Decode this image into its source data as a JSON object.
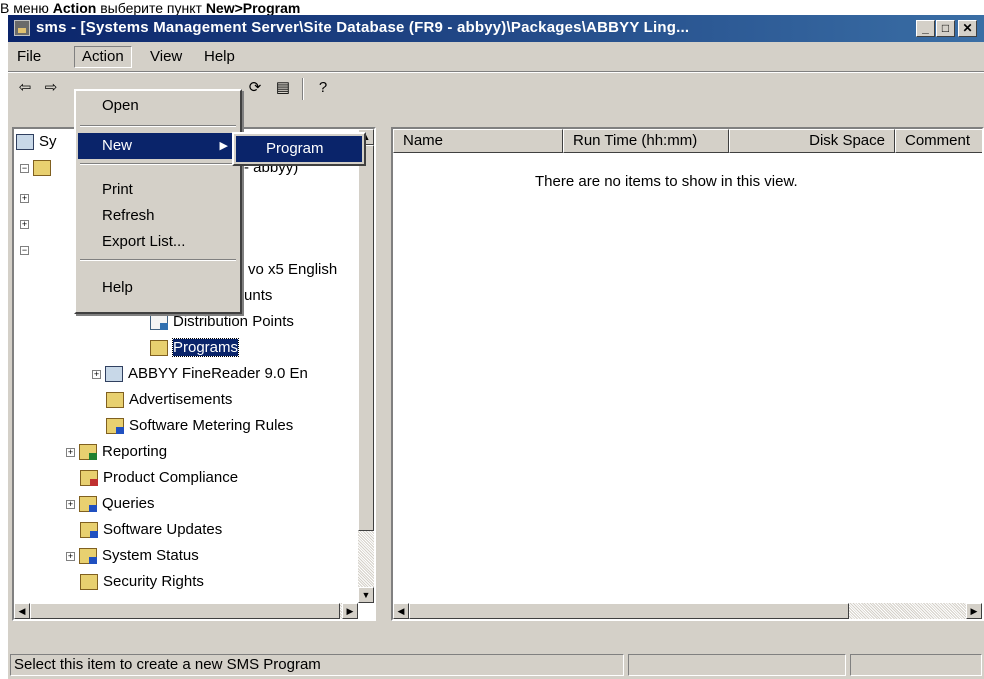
{
  "caption": {
    "prefix": "В меню ",
    "menu": "Action",
    "middle": " выберите пункт ",
    "item": "New>Program"
  },
  "window": {
    "title": "sms - [Systems Management Server\\Site Database (FR9 - abbyy)\\Packages\\ABBYY Ling..."
  },
  "menubar": {
    "items": [
      "File",
      "Action",
      "View",
      "Help"
    ]
  },
  "action_menu": {
    "items": [
      "Open",
      "New",
      "Print",
      "Refresh",
      "Export List...",
      "Help"
    ],
    "highlighted": "New"
  },
  "new_submenu": {
    "items": [
      "Program"
    ]
  },
  "tree": {
    "root_partial": "Sy",
    "site_partial": "- abbyy)",
    "package_partial": "vo x5 English",
    "access_partial": "Access Accounts",
    "items": [
      {
        "label": "Distribution Points",
        "icon": "distribution-points-icon"
      },
      {
        "label": "Programs",
        "icon": "programs-icon",
        "selected": true
      },
      {
        "label": "ABBYY FineReader 9.0 En",
        "icon": "package-icon"
      },
      {
        "label": "Advertisements",
        "icon": "advertisements-icon"
      },
      {
        "label": "Software Metering Rules",
        "icon": "software-metering-icon"
      },
      {
        "label": "Reporting",
        "icon": "reporting-icon"
      },
      {
        "label": "Product Compliance",
        "icon": "product-compliance-icon"
      },
      {
        "label": "Queries",
        "icon": "queries-icon"
      },
      {
        "label": "Software Updates",
        "icon": "software-updates-icon"
      },
      {
        "label": "System Status",
        "icon": "system-status-icon"
      },
      {
        "label": "Security Rights",
        "icon": "security-rights-icon"
      }
    ]
  },
  "list": {
    "columns": [
      "Name",
      "Run Time (hh:mm)",
      "Disk Space",
      "Comment"
    ],
    "empty_message": "There are no items to show in this view."
  },
  "statusbar": {
    "text": "Select this item to create a new SMS Program"
  }
}
